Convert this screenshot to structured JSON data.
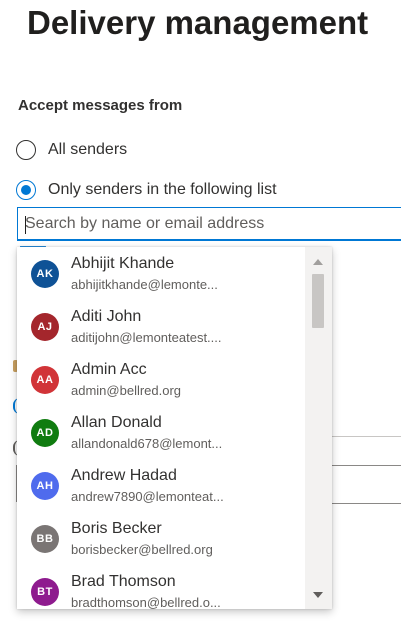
{
  "page": {
    "title": "Delivery management"
  },
  "accept_messages": {
    "label": "Accept messages from",
    "options": [
      {
        "label": "All senders",
        "selected": false
      },
      {
        "label": "Only senders in the following list",
        "selected": true
      }
    ]
  },
  "search": {
    "placeholder": "Search by name or email address",
    "value": ""
  },
  "dropdown": {
    "items": [
      {
        "initials": "AK",
        "name": "Abhijit Khande",
        "email": "abhijitkhande@lemonte...",
        "color": "#0f5296"
      },
      {
        "initials": "AJ",
        "name": "Aditi John",
        "email": "aditijohn@lemonteatest....",
        "color": "#a4262c"
      },
      {
        "initials": "AA",
        "name": "Admin Acc",
        "email": "admin@bellred.org",
        "color": "#d13438"
      },
      {
        "initials": "AD",
        "name": "Allan Donald",
        "email": "allandonald678@lemont...",
        "color": "#107c10"
      },
      {
        "initials": "AH",
        "name": "Andrew Hadad",
        "email": "andrew7890@lemonteat...",
        "color": "#4f6bed"
      },
      {
        "initials": "BB",
        "name": "Boris Becker",
        "email": "borisbecker@bellred.org",
        "color": "#7a7574"
      },
      {
        "initials": "BT",
        "name": "Brad Thomson",
        "email": "bradthomson@bellred.o...",
        "color": "#8e1b8e"
      }
    ]
  },
  "icons": {
    "scroll_up": "chevron-up-icon",
    "scroll_down": "chevron-down-icon"
  },
  "colors": {
    "accent": "#0078d4"
  }
}
